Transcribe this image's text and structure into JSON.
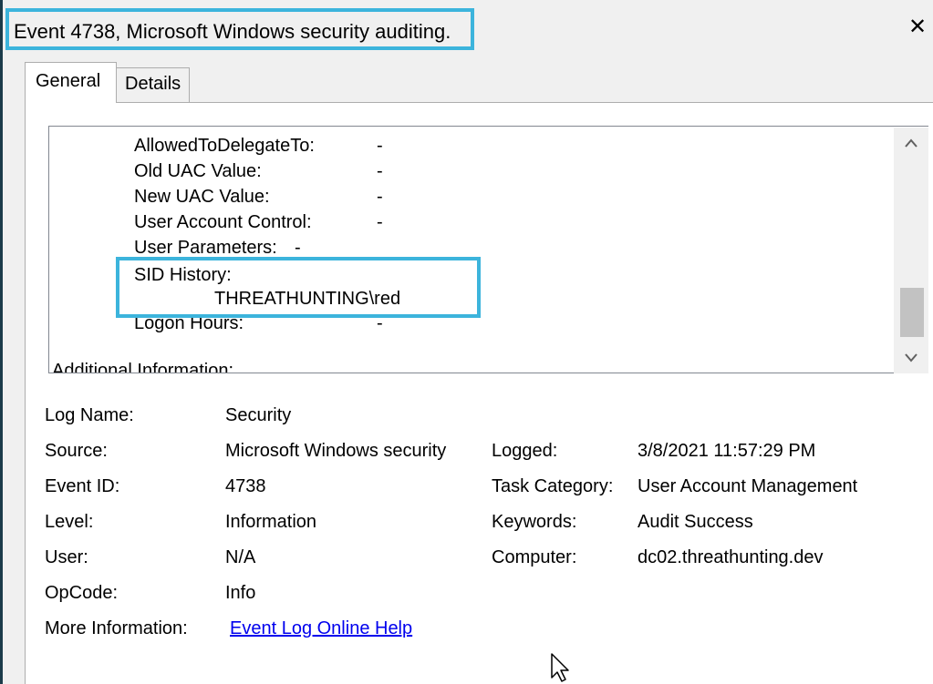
{
  "window": {
    "title": "Event 4738, Microsoft Windows security auditing.",
    "close_glyph": "✕"
  },
  "tabs": [
    {
      "label": "General",
      "active": true
    },
    {
      "label": "Details",
      "active": false
    }
  ],
  "description": {
    "rows": [
      {
        "label": "AllowedToDelegateTo:",
        "value": "-"
      },
      {
        "label": "Old UAC Value:",
        "value": "-"
      },
      {
        "label": "New UAC Value:",
        "value": "-"
      },
      {
        "label": "User Account Control:",
        "value": "-"
      },
      {
        "label": "User Parameters:",
        "value": "-"
      },
      {
        "label": "SID History:",
        "value": ""
      },
      {
        "label": "",
        "value": "THREATHUNTING\\red"
      },
      {
        "label": "Logon Hours:",
        "value": "-"
      }
    ],
    "partial_line": "Additional Information:"
  },
  "scrollbar": {
    "up_glyph": "^",
    "down_glyph": "v"
  },
  "details": {
    "log_name": {
      "label": "Log Name:",
      "value": "Security"
    },
    "source": {
      "label": "Source:",
      "value": "Microsoft Windows security"
    },
    "logged": {
      "label": "Logged:",
      "value": "3/8/2021 11:57:29 PM"
    },
    "event_id": {
      "label": "Event ID:",
      "value": "4738"
    },
    "task_category": {
      "label": "Task Category:",
      "value": "User Account Management"
    },
    "level": {
      "label": "Level:",
      "value": "Information"
    },
    "keywords": {
      "label": "Keywords:",
      "value": "Audit Success"
    },
    "user": {
      "label": "User:",
      "value": "N/A"
    },
    "computer": {
      "label": "Computer:",
      "value": "dc02.threathunting.dev"
    },
    "opcode": {
      "label": "OpCode:",
      "value": "Info"
    },
    "more_information": {
      "label": "More Information:",
      "link_text": "Event Log Online Help"
    }
  },
  "colors": {
    "highlight": "#3cb4dc",
    "window_bg": "#f0f0f0",
    "link": "#0000ee"
  }
}
